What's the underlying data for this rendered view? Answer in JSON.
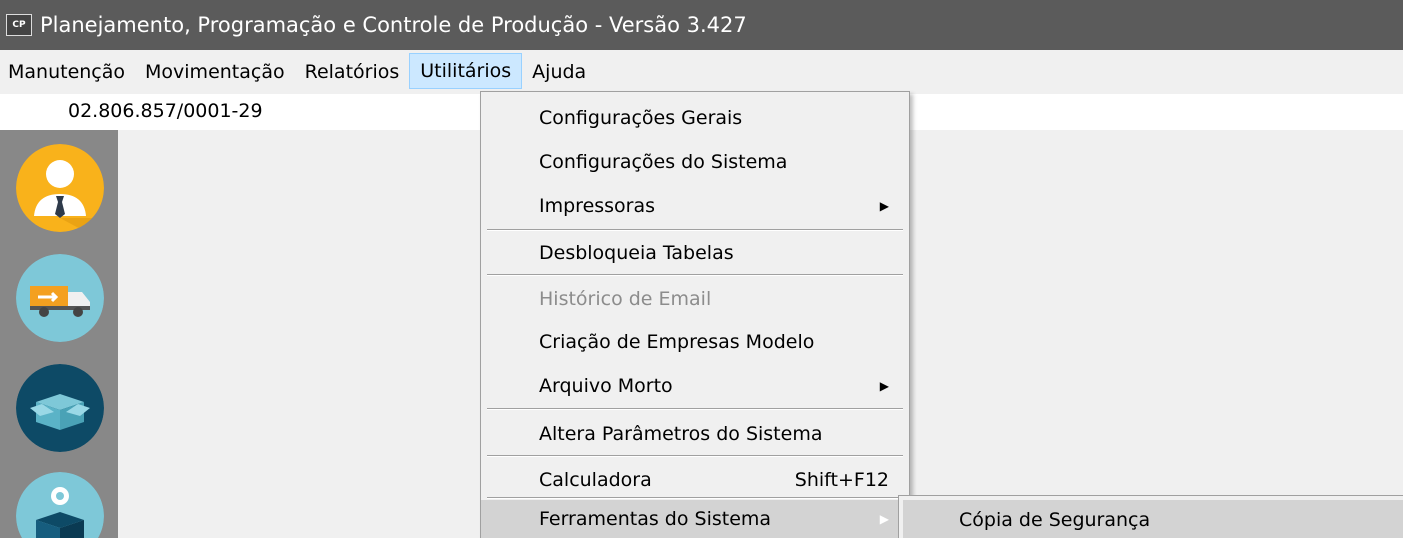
{
  "window": {
    "icon_text": "CP",
    "title": "Planejamento, Programação e Controle de Produção - Versão 3.427"
  },
  "menubar": {
    "items": [
      {
        "label": "Manutenção"
      },
      {
        "label": "Movimentação"
      },
      {
        "label": "Relatórios"
      },
      {
        "label": "Utilitários",
        "active": true
      },
      {
        "label": "Ajuda"
      }
    ]
  },
  "company": {
    "cnpj": "02.806.857/0001-29"
  },
  "sidebar": {
    "buttons": [
      {
        "icon": "user-icon",
        "color": "#f9b21b"
      },
      {
        "icon": "truck-icon",
        "color": "#7ec8d8"
      },
      {
        "icon": "box-icon",
        "color": "#0d4a66"
      },
      {
        "icon": "gear-box-icon",
        "color": "#7ec8d8"
      }
    ]
  },
  "utilitarios_menu": {
    "items": [
      {
        "label": "Configurações Gerais"
      },
      {
        "label": "Configurações do Sistema"
      },
      {
        "label": "Impressoras",
        "submenu": true
      },
      {
        "label": "Desbloqueia Tabelas"
      },
      {
        "label": "Histórico de Email",
        "disabled": true
      },
      {
        "label": "Criação de Empresas Modelo"
      },
      {
        "label": "Arquivo Morto",
        "submenu": true
      },
      {
        "label": "Altera Parâmetros do Sistema"
      },
      {
        "label": "Calculadora",
        "shortcut": "Shift+F12"
      },
      {
        "label": "Ferramentas do Sistema",
        "submenu": true,
        "highlighted": true
      }
    ]
  },
  "ferramentas_submenu": {
    "items": [
      {
        "label": "Cópia de Segurança",
        "highlighted": true
      }
    ]
  },
  "colors": {
    "titlebar": "#5b5b5b",
    "menubar": "#f0f0f0",
    "menu_active": "#cce8ff",
    "sidebar": "#888888",
    "highlight": "#d3d3d3"
  }
}
